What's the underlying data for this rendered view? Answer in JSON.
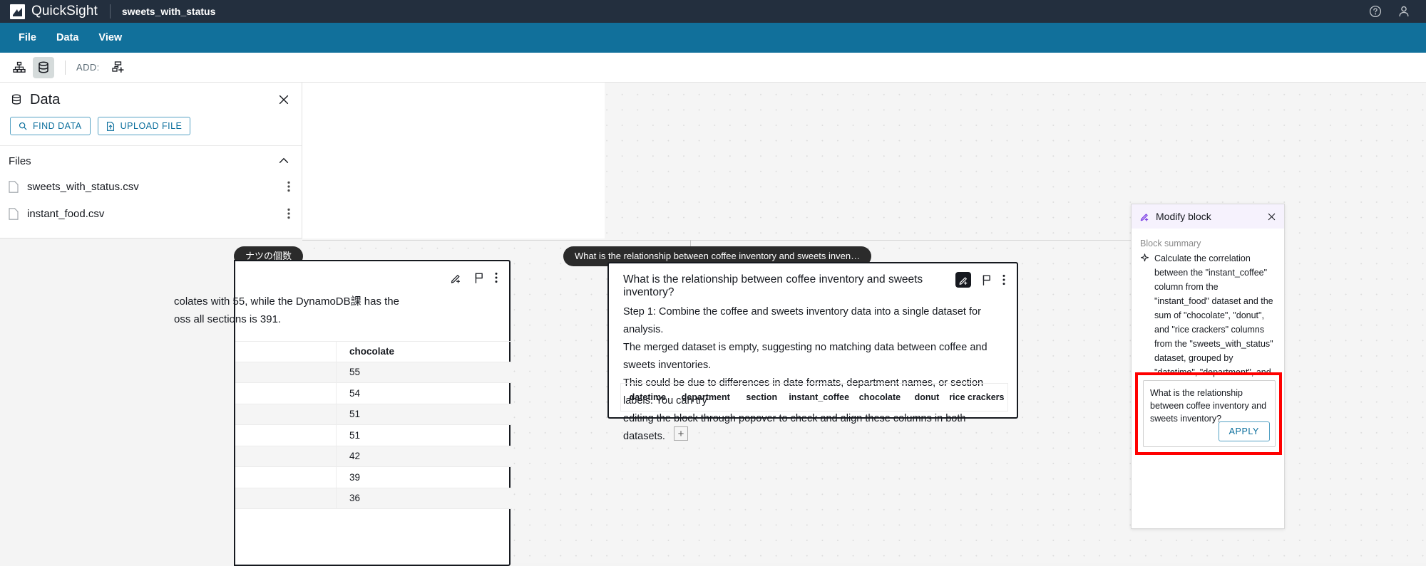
{
  "topbar": {
    "brand": "QuickSight",
    "doc_title": "sweets_with_status",
    "help_icon": "help-circle-icon",
    "user_icon": "user-account-icon"
  },
  "menubar": {
    "items": [
      {
        "label": "File"
      },
      {
        "label": "Data"
      },
      {
        "label": "View"
      }
    ]
  },
  "toolstrip": {
    "flow_icon": "hierarchy-flow-icon",
    "data_icon": "database-icon",
    "add_label": "ADD:",
    "add_block_icon": "add-block-icon"
  },
  "data_panel": {
    "title": "Data",
    "title_icon": "database-icon",
    "close_icon": "close-icon",
    "find_data_label": "FIND DATA",
    "find_data_icon": "search-icon",
    "upload_file_label": "UPLOAD FILE",
    "upload_file_icon": "upload-file-icon",
    "files_label": "Files",
    "collapse_icon": "chevron-up-icon",
    "files": [
      {
        "name": "sweets_with_status.csv",
        "icon": "file-icon",
        "menu_icon": "kebab-menu-icon"
      },
      {
        "name": "instant_food.csv",
        "icon": "file-icon",
        "menu_icon": "kebab-menu-icon"
      }
    ]
  },
  "canvas": {
    "add_block_label": "+",
    "left_block": {
      "pill_label": "ナツの個数",
      "narrative": "colates with 55, while the DynamoDB課 has the\noss all sections is 391.",
      "edit_icon": "edit-sparkle-icon",
      "flag_icon": "flag-icon",
      "more_icon": "kebab-menu-icon",
      "table": {
        "column": "chocolate",
        "values": [
          "55",
          "54",
          "51",
          "51",
          "42",
          "39",
          "36"
        ]
      }
    },
    "main_block": {
      "pill_label": "What is the relationship between coffee inventory and sweets inven…",
      "question": "What is the relationship between coffee inventory and sweets inventory?",
      "edit_icon": "edit-sparkle-icon",
      "flag_icon": "flag-icon",
      "more_icon": "kebab-menu-icon",
      "body": "Step 1: Combine the coffee and sweets inventory data into a single dataset for analysis.\nThe merged dataset is empty, suggesting no matching data between coffee and sweets inventories.\nThis could be due to differences in date formats, department names, or section labels. You can try\nediting the block through popover to check and align these columns in both datasets.",
      "table_columns": [
        "datetime",
        "department",
        "section",
        "instant_coffee",
        "chocolate",
        "donut",
        "rice crackers"
      ]
    }
  },
  "modify_panel": {
    "title": "Modify block",
    "title_icon": "edit-sparkle-icon",
    "close_icon": "close-icon",
    "summary_label": "Block summary",
    "summary_icon": "sparkle-icon",
    "summary_text": "Calculate the correlation between the \"instant_coffee\" column from the \"instant_food\" dataset and the sum of \"chocolate\", \"donut\", and \"rice crackers\" columns from the \"sweets_with_status\" dataset, grouped by \"datetime\", \"department\", and \"section\"",
    "prompt_value": "What is the relationship between coffee inventory and sweets inventory?",
    "apply_label": "APPLY",
    "highlight_color": "#ff0000"
  },
  "colors": {
    "topbar_bg": "#232f3e",
    "menubar_bg": "#11709b",
    "link_blue": "#0a6e9c",
    "accent_purple": "#7b3fe4"
  }
}
